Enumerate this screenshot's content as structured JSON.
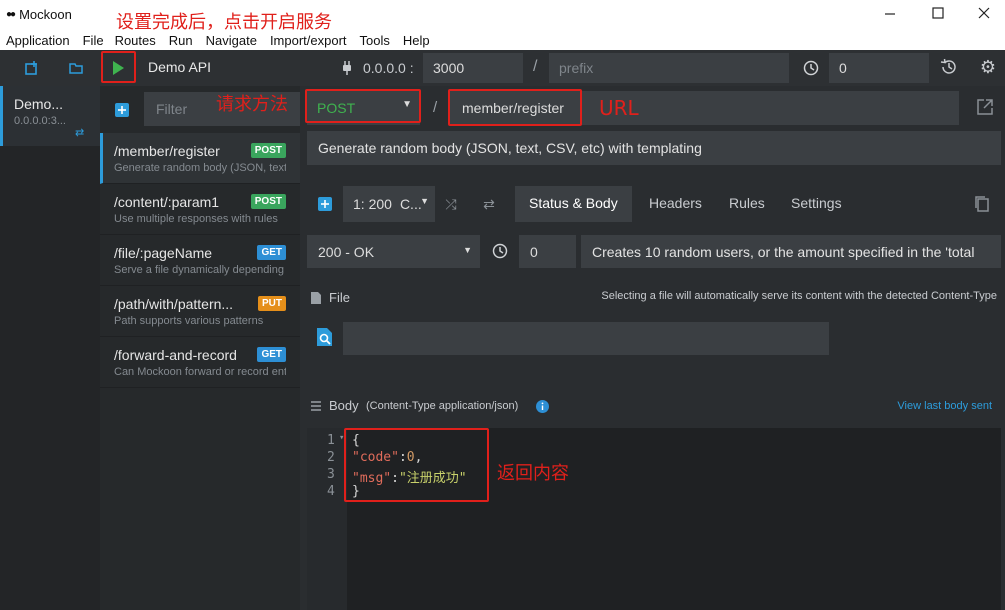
{
  "app": {
    "title": "Mockoon"
  },
  "menu": [
    "Application",
    "File",
    "Routes",
    "Run",
    "Navigate",
    "Import/export",
    "Tools",
    "Help"
  ],
  "environment": {
    "name": "Demo API",
    "sidebar_name": "Demo...",
    "sidebar_host": "0.0.0.0:3...",
    "host": "0.0.0.0 :",
    "port": "3000",
    "prefix_placeholder": "prefix",
    "latency": "0"
  },
  "filter": {
    "placeholder": "Filter"
  },
  "routes": [
    {
      "path": "/member/register",
      "desc": "Generate random body (JSON, text, CSV, etc) with templating",
      "method": "POST"
    },
    {
      "path": "/content/:param1",
      "desc": "Use multiple responses with rules",
      "method": "POST"
    },
    {
      "path": "/file/:pageName",
      "desc": "Serve a file dynamically depending on the path param",
      "method": "GET"
    },
    {
      "path": "/path/with/pattern...",
      "desc": "Path supports various patterns",
      "method": "PUT"
    },
    {
      "path": "/forward-and-record",
      "desc": "Can Mockoon forward or record entering requests?",
      "method": "GET"
    }
  ],
  "route_editor": {
    "method": "POST",
    "slash": "/",
    "path": "member/register",
    "description": "Generate random body (JSON, text, CSV, etc) with templating"
  },
  "response": {
    "selector": "1: 200",
    "selector_extra": "C...",
    "tabs": [
      "Status & Body",
      "Headers",
      "Rules",
      "Settings"
    ],
    "status": "200 - OK",
    "delay": "0",
    "label": "Creates 10 random users, or the amount specified in the 'total"
  },
  "file": {
    "label": "File",
    "hint": "Selecting a file will automatically serve its content with the detected Content-Type"
  },
  "body": {
    "label": "Body",
    "content_type": "(Content-Type application/json)",
    "view_last": "View last body sent",
    "line_numbers": [
      "1",
      "2",
      "3",
      "4"
    ],
    "code_lines": {
      "l1": "{",
      "l2_key": "\"code\"",
      "l2_colon": ":",
      "l2_val": "0",
      "l2_comma": ",",
      "l3_key": "\"msg\"",
      "l3_colon": ":",
      "l3_val": "\"注册成功\"",
      "l4": "}"
    }
  },
  "annotations": {
    "start": "设置完成后，点击开启服务",
    "method": "请求方法",
    "url": "URL",
    "content": "返回内容"
  },
  "colors": {
    "accent": "#2d9cdb",
    "post": "#3aa55d",
    "get": "#2d8fd5",
    "put": "#e58f1a",
    "annotation": "#e0201b",
    "play": "#3fb34f"
  }
}
